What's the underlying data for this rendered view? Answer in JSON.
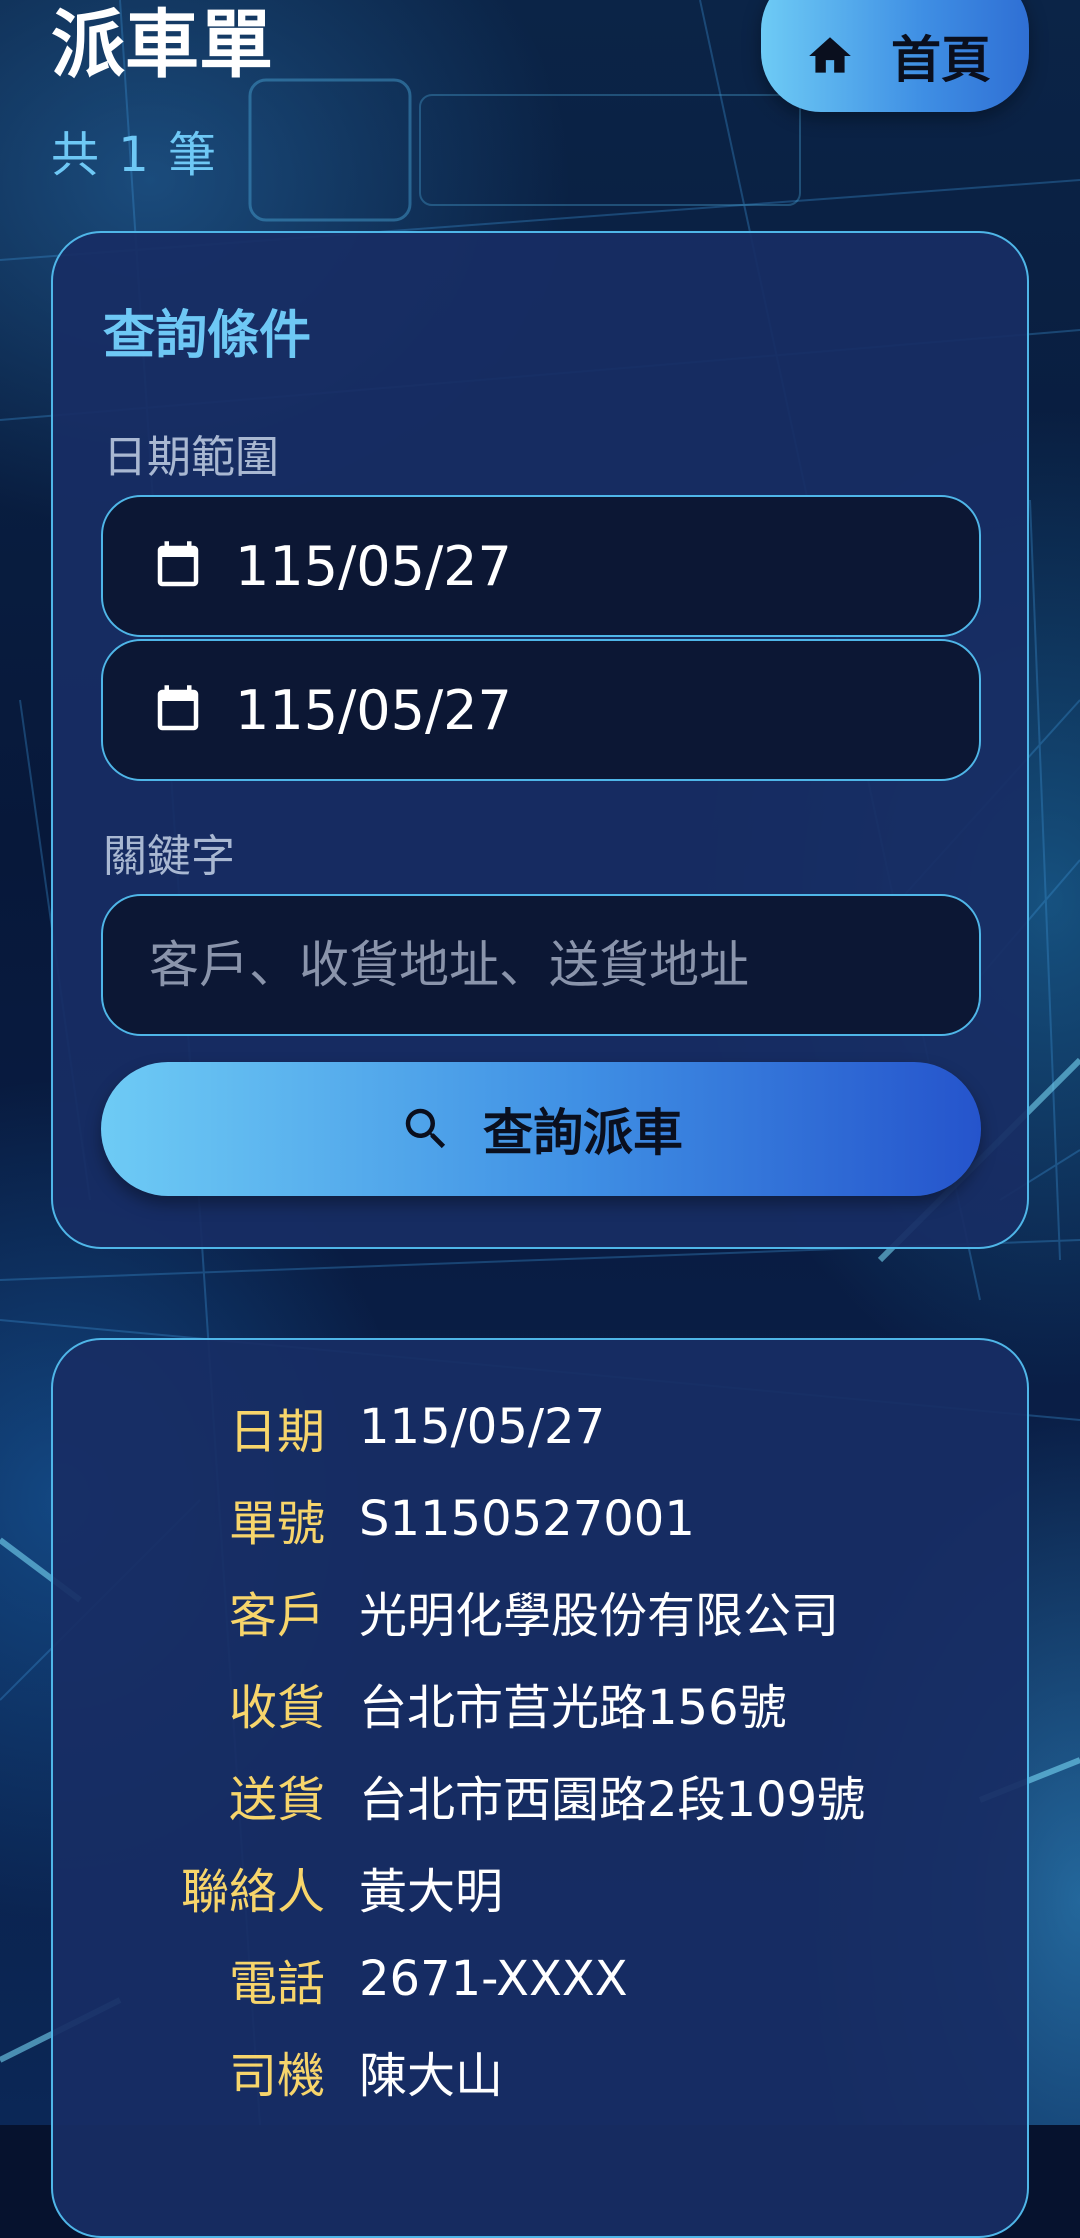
{
  "header": {
    "title": "派車單",
    "record_count": "共 1 筆",
    "home_button": "首頁"
  },
  "query": {
    "section_title": "查詢條件",
    "date_range_label": "日期範圍",
    "start_date": "115/05/27",
    "end_date": "115/05/27",
    "keyword_label": "關鍵字",
    "keyword_value": "",
    "keyword_placeholder": "客戶、收貨地址、送貨地址",
    "search_button": "查詢派車"
  },
  "result": {
    "fields": [
      {
        "label": "日期",
        "value": "115/05/27"
      },
      {
        "label": "單號",
        "value": "S1150527001"
      },
      {
        "label": "客戶",
        "value": "光明化學股份有限公司"
      },
      {
        "label": "收貨",
        "value": "台北市莒光路156號"
      },
      {
        "label": "送貨",
        "value": "台北市西園路2段109號"
      },
      {
        "label": "聯絡人",
        "value": "黃大明"
      },
      {
        "label": "電話",
        "value": "2671-XXXX"
      },
      {
        "label": "司機",
        "value": "陳大山"
      }
    ]
  },
  "colors": {
    "accent": "#6ec8f5",
    "label_yellow": "#f7d56b",
    "card_bg": "#182d64",
    "border": "#4fb6e8"
  },
  "icons": {
    "home": "home-icon",
    "calendar": "calendar-icon",
    "search": "search-icon"
  }
}
